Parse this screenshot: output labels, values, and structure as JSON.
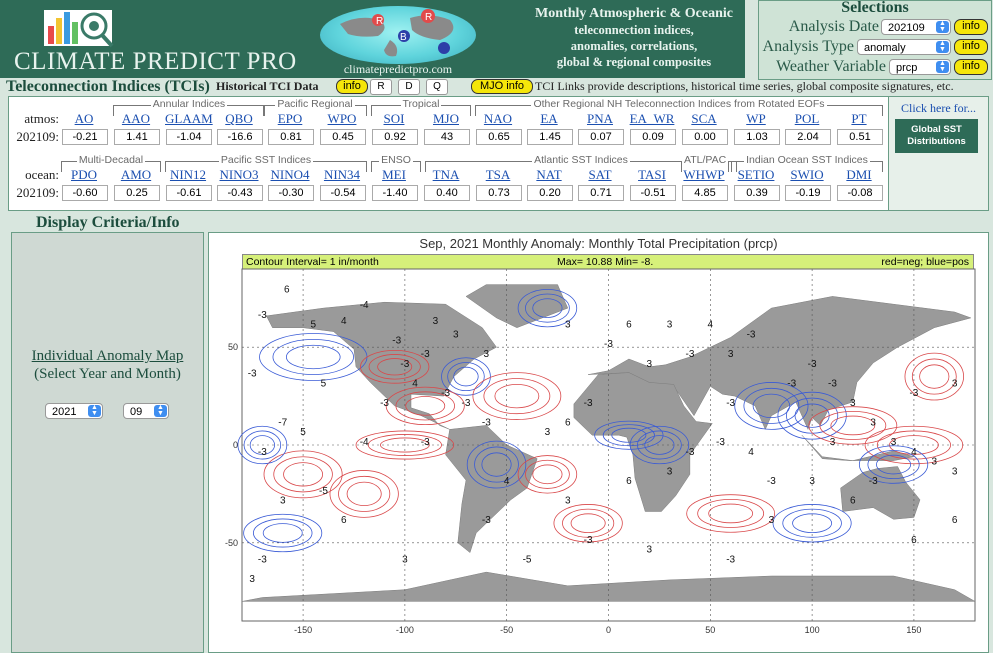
{
  "header": {
    "logo_text": "CLIMATE PREDICT PRO",
    "site": "climatepredictpro.com",
    "tagline": [
      "Monthly Atmospheric & Oceanic",
      "teleconnection indices,",
      "anomalies, correlations,",
      "global & regional composites"
    ]
  },
  "selections": {
    "title": "Selections",
    "analysis_date_label": "Analysis Date",
    "analysis_date_value": "202109",
    "analysis_type_label": "Analysis Type",
    "analysis_type_value": "anomaly",
    "weather_variable_label": "Weather Variable",
    "weather_variable_value": "prcp",
    "info_label": "info"
  },
  "tci_bar": {
    "title": "Teleconnection Indices (TCIs)",
    "historical": "Historical TCI Data",
    "info": "info",
    "r": "R",
    "d": "D",
    "q": "Q",
    "mjo_info": "MJO info",
    "links_text": "TCI Links provide descriptions, historical time series, global composite signatures, etc."
  },
  "row1": {
    "label": "atmos:",
    "date_label": "202109:",
    "groups": [
      "Annular Indices",
      "Pacific Regional",
      "Tropical",
      "Other Regional NH Teleconnection Indices from Rotated EOFs"
    ],
    "names": [
      "AO",
      "AAO",
      "GLAAM",
      "QBO",
      "EPO",
      "WPO",
      "SOI",
      "MJO",
      "NAO",
      "EA",
      "PNA",
      "EA_WR",
      "SCA",
      "WP",
      "POL",
      "PT"
    ],
    "values": [
      "-0.21",
      "1.41",
      "-1.04",
      "-16.6",
      "0.81",
      "0.45",
      "0.92",
      "43",
      "0.65",
      "1.45",
      "0.07",
      "0.09",
      "0.00",
      "1.03",
      "2.04",
      "0.51"
    ]
  },
  "row2": {
    "label": "ocean:",
    "date_label": "202109:",
    "groups": [
      "Multi-Decadal",
      "Pacific SST Indices",
      "ENSO",
      "Atlantic SST Indices",
      "ATL/PAC",
      "Indian Ocean SST Indices"
    ],
    "names": [
      "PDO",
      "AMO",
      "NIN12",
      "NINO3",
      "NINO4",
      "NIN34",
      "MEI",
      "TNA",
      "TSA",
      "NAT",
      "SAT",
      "TASI",
      "WHWP",
      "SETIO",
      "SWIO",
      "DMI"
    ],
    "values": [
      "-0.60",
      "0.25",
      "-0.61",
      "-0.43",
      "-0.30",
      "-0.54",
      "-1.40",
      "0.40",
      "0.73",
      "0.20",
      "0.71",
      "-0.51",
      "4.85",
      "0.39",
      "-0.19",
      "-0.08"
    ]
  },
  "side": {
    "click_here": "Click here for...",
    "sst_button": "Global SST Distributions"
  },
  "display": {
    "title": "Display Criteria/Info",
    "link_line1": "Individual Anomaly Map",
    "link_line2": "(Select Year and Month)",
    "year": "2021",
    "month": "09"
  },
  "map": {
    "title": "Sep, 2021   Monthly Anomaly: Monthly Total Precipitation (prcp)",
    "contour_interval": "Contour Interval= 1 in/month",
    "max_min": "Max= 10.88  Min= -8.",
    "legend_note": "red=neg; blue=pos",
    "lat_ticks": [
      "50",
      "0",
      "-50"
    ],
    "lon_ticks": [
      "-150",
      "-100",
      "-50",
      "0",
      "50",
      "100",
      "150"
    ],
    "contour_labels": [
      "6",
      "-3",
      "5",
      "-4",
      "3",
      "4",
      "-3",
      "3",
      "3",
      "-3",
      "-3",
      "4",
      "-3",
      "-3",
      "-3",
      "-7",
      "5",
      "-4",
      "-3",
      "-5",
      "6",
      "-3",
      "3",
      "3",
      "-3",
      "3",
      "-3",
      "3",
      "-3",
      "6",
      "3",
      "4",
      "3",
      "6",
      "3",
      "-3",
      "-3",
      "4",
      "-3",
      "-3",
      "3",
      "3",
      "3",
      "4",
      "3",
      "3",
      "-3",
      "-5",
      "3",
      "-3",
      "3",
      "6",
      "6",
      "6",
      "5",
      "-3",
      "-3",
      "6",
      "3",
      "4",
      "-3",
      "-3",
      "3",
      "-3",
      "-3",
      "3",
      "-3",
      "3",
      "-3",
      "3",
      "-3",
      "-3",
      "3"
    ],
    "colors": {
      "positive": "#3a5bd6",
      "negative": "#d9484a",
      "land": "#9a9a9a"
    }
  }
}
